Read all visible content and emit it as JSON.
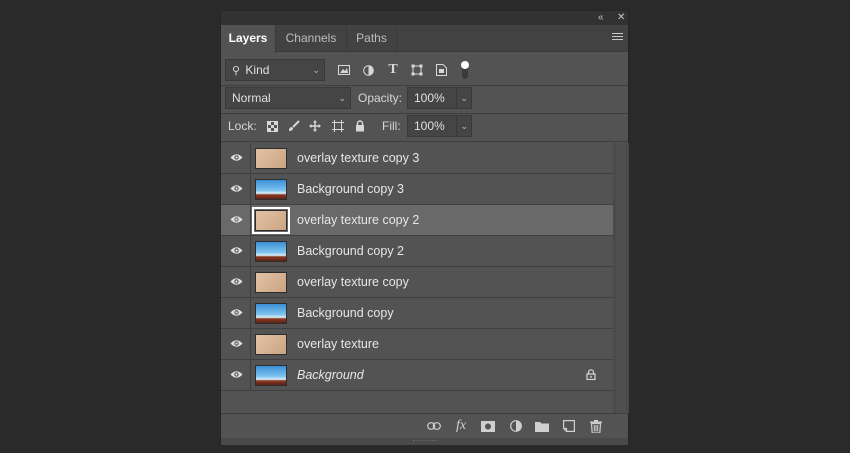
{
  "tabs": [
    {
      "label": "Layers",
      "active": true
    },
    {
      "label": "Channels",
      "active": false
    },
    {
      "label": "Paths",
      "active": false
    }
  ],
  "titlebar": {
    "collapse_icon": "double-chevron-left-icon",
    "close_icon": "close-icon"
  },
  "filter": {
    "kind_label": "Kind",
    "icons": [
      "pixel-layer-filter-icon",
      "adjustment-layer-filter-icon",
      "type-layer-filter-icon",
      "shape-layer-filter-icon",
      "smart-object-filter-icon",
      "filter-toggle-icon"
    ]
  },
  "blend": {
    "mode": "Normal",
    "opacity_label": "Opacity:",
    "opacity_value": "100%"
  },
  "lock": {
    "label": "Lock:",
    "icons": [
      "lock-transparent-pixels-icon",
      "lock-image-pixels-icon",
      "lock-position-icon",
      "lock-artboard-icon",
      "lock-all-icon"
    ],
    "fill_label": "Fill:",
    "fill_value": "100%"
  },
  "layers": [
    {
      "name": "overlay texture copy 3",
      "thumb": "texture",
      "selected": false,
      "italic": false,
      "locked": false
    },
    {
      "name": "Background copy 3",
      "thumb": "sky",
      "selected": false,
      "italic": false,
      "locked": false
    },
    {
      "name": "overlay texture copy 2",
      "thumb": "texture",
      "selected": true,
      "italic": false,
      "locked": false
    },
    {
      "name": "Background copy 2",
      "thumb": "sky",
      "selected": false,
      "italic": false,
      "locked": false
    },
    {
      "name": "overlay texture copy",
      "thumb": "texture",
      "selected": false,
      "italic": false,
      "locked": false
    },
    {
      "name": "Background copy",
      "thumb": "sky",
      "selected": false,
      "italic": false,
      "locked": false
    },
    {
      "name": "overlay texture",
      "thumb": "texture",
      "selected": false,
      "italic": false,
      "locked": false
    },
    {
      "name": "Background",
      "thumb": "sky",
      "selected": false,
      "italic": true,
      "locked": true
    }
  ],
  "bottom_icons": [
    "link-layers-icon",
    "layer-style-fx-icon",
    "add-mask-icon",
    "new-adjustment-layer-icon",
    "new-group-folder-icon",
    "new-layer-icon",
    "delete-layer-icon"
  ],
  "bottom_fx_text": "fx"
}
